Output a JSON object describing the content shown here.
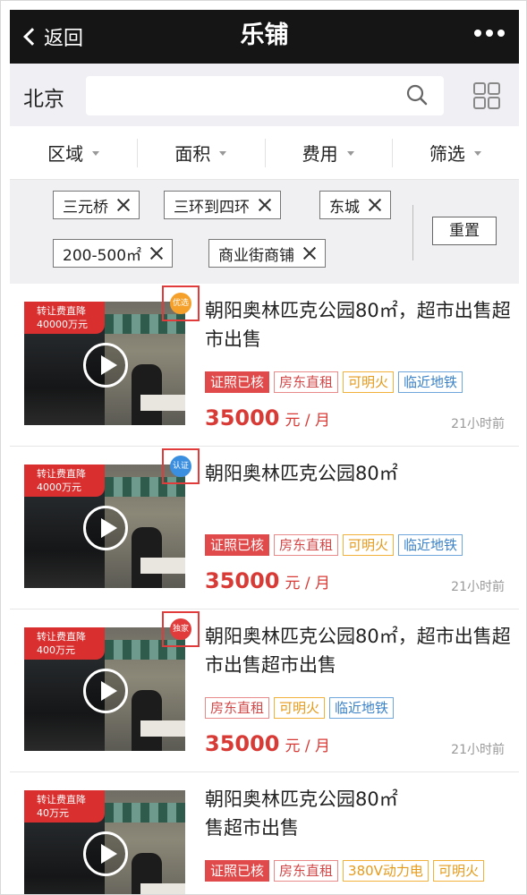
{
  "nav": {
    "back_label": "返回",
    "title": "乐铺"
  },
  "search": {
    "city": "北京",
    "placeholder": ""
  },
  "filters": [
    {
      "label": "区域"
    },
    {
      "label": "面积"
    },
    {
      "label": "费用"
    },
    {
      "label": "筛选"
    }
  ],
  "chips": [
    {
      "label": "三元桥"
    },
    {
      "label": "三环到四环"
    },
    {
      "label": "东城"
    },
    {
      "label": "200-500㎡"
    },
    {
      "label": "商业街商铺"
    }
  ],
  "reset_label": "重置",
  "listings": [
    {
      "promo_line1": "转让费直降",
      "promo_amount": "40000万元",
      "badge": "优选",
      "badge_color": "#f5a02a",
      "title": "朝阳奥林匹克公园80㎡，超市出售超市出售",
      "tags": [
        "证照已核",
        "房东直租",
        "可明火",
        "临近地铁"
      ],
      "price": "35000",
      "unit": "元 / 月",
      "time": "21小时前"
    },
    {
      "promo_line1": "转让费直降",
      "promo_amount": "4000万元",
      "badge": "认证",
      "badge_color": "#3b8fe0",
      "title": "朝阳奥林匹克公园80㎡",
      "tags": [
        "证照已核",
        "房东直租",
        "可明火",
        "临近地铁"
      ],
      "price": "35000",
      "unit": "元 / 月",
      "time": "21小时前"
    },
    {
      "promo_line1": "转让费直降",
      "promo_amount": "400万元",
      "badge": "独家",
      "badge_color": "#e23b3b",
      "title": "朝阳奥林匹克公园80㎡，超市出售超市出售超市出售",
      "tags": [
        "房东直租",
        "可明火",
        "临近地铁"
      ],
      "price": "35000",
      "unit": "元 / 月",
      "time": "21小时前"
    },
    {
      "promo_line1": "转让费直降",
      "promo_amount": "40万元",
      "title": "朝阳奥林匹克公园80㎡\n售超市出售",
      "tags": [
        "证照已核",
        "房东直租",
        "380V动力电",
        "可明火"
      ]
    }
  ]
}
